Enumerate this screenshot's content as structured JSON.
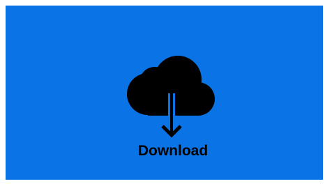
{
  "download_button": {
    "label": "Download",
    "icon": "cloud-download-icon",
    "background_color": "#0a74e6",
    "foreground_color": "#000000"
  }
}
